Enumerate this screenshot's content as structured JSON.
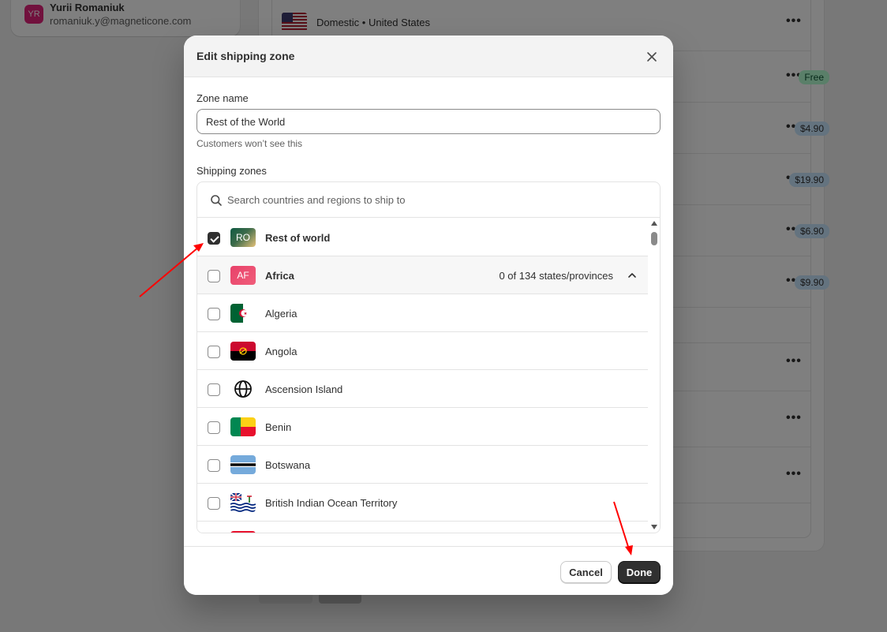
{
  "background": {
    "user": {
      "initials": "YR",
      "name": "Yurii Romaniuk",
      "email": "romaniuk.y@magneticone.com"
    },
    "zone_title": "Domestic • United States",
    "prices": [
      "Free",
      "$4.90",
      "$19.90",
      "$6.90",
      "$9.90"
    ],
    "colors": {
      "page_bg": "#f1f1f1",
      "free_badge": "#b4fed2",
      "price_badge": "#c9e6ff"
    }
  },
  "modal": {
    "title": "Edit shipping zone",
    "zone_name_label": "Zone name",
    "zone_name_value": "Rest of the World",
    "zone_name_help": "Customers won’t see this",
    "shipping_zones_label": "Shipping zones",
    "search_placeholder": "Search countries and regions to ship to",
    "rows": [
      {
        "label": "Rest of world",
        "badge": "RO",
        "checked": true,
        "bold": true
      },
      {
        "label": "Africa",
        "badge": "AF",
        "checked": false,
        "bold": true,
        "count": "0 of 134 states/provinces",
        "expanded": true
      },
      {
        "label": "Algeria",
        "flag": "algeria-flag-icon",
        "checked": false
      },
      {
        "label": "Angola",
        "flag": "angola-flag-icon",
        "checked": false
      },
      {
        "label": "Ascension Island",
        "flag": "globe-icon",
        "checked": false
      },
      {
        "label": "Benin",
        "flag": "benin-flag-icon",
        "checked": false
      },
      {
        "label": "Botswana",
        "flag": "botswana-flag-icon",
        "checked": false
      },
      {
        "label": "British Indian Ocean Territory",
        "flag": "biot-flag-icon",
        "checked": false
      }
    ],
    "cancel_label": "Cancel",
    "done_label": "Done",
    "colors": {
      "primary_button": "#303030",
      "annotation_arrow": "#ff0000"
    }
  }
}
